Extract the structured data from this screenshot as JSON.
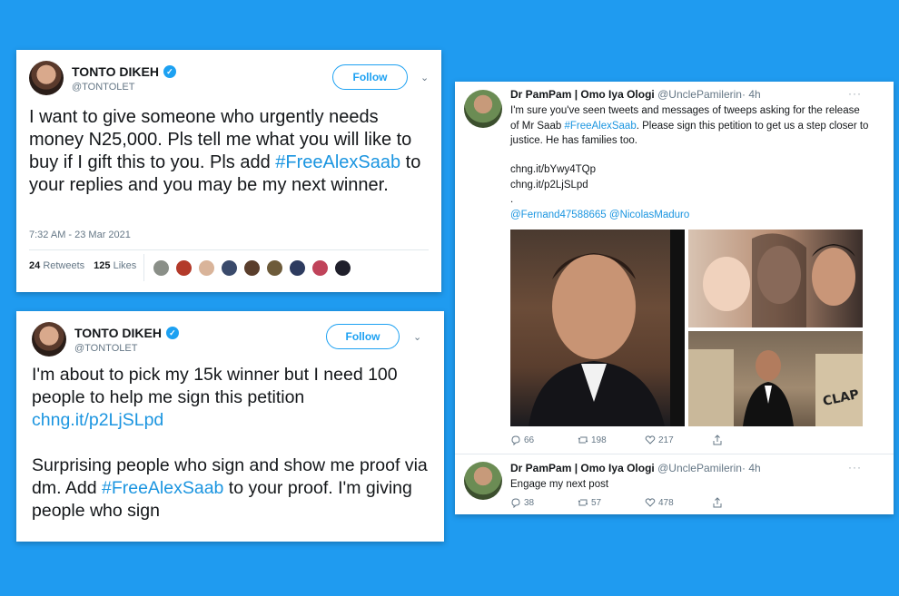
{
  "tweet1": {
    "display_name": "TONTO DIKEH",
    "handle": "@TONTOLET",
    "follow_label": "Follow",
    "text_before": "I want to give someone who urgently needs money N25,000. Pls tell me what you will like to buy if I gift this to you. Pls add ",
    "hashtag": "#FreeAlexSaab",
    "text_after": " to your replies and you may be my next winner.",
    "timestamp": "7:32 AM - 23 Mar 2021",
    "retweets_count": "24",
    "retweets_label": "Retweets",
    "likes_count": "125",
    "likes_label": "Likes"
  },
  "tweet2": {
    "display_name": "TONTO DIKEH",
    "handle": "@TONTOLET",
    "follow_label": "Follow",
    "line1": "I'm about to pick my 15k winner but I need 100 people to help me sign this petition",
    "link": "chng.it/p2LjSLpd",
    "para2_before": "Surprising people who sign and show me proof via dm. Add ",
    "hashtag": "#FreeAlexSaab",
    "para2_after": " to your proof. I'm giving people who sign"
  },
  "tweet3": {
    "display_name": "Dr PamPam | Omo Iya Ologi",
    "handle": "@UnclePamilerin",
    "time": "· 4h",
    "text_before": "I'm sure you've seen tweets and messages of tweeps asking for the release of Mr Saab ",
    "hashtag": "#FreeAlexSaab",
    "text_after": ". Please sign this petition to get us a step closer to justice. He has families too.",
    "link1": "chng.it/bYwy4TQp",
    "link2": "chng.it/p2LjSLpd",
    "dot": ".",
    "mention1": "@Fernand47588665",
    "mention2": "@NicolasMaduro",
    "photo_sign_text": "CLAP",
    "replies": "66",
    "retweets": "198",
    "likes": "217"
  },
  "tweet4": {
    "display_name": "Dr PamPam | Omo Iya Ologi",
    "handle": "@UnclePamilerin",
    "time": "· 4h",
    "text": "Engage my next post",
    "replies": "38",
    "retweets": "57",
    "likes": "478"
  },
  "colors": {
    "background": "#1f9bf0",
    "link": "#1b95e0",
    "verified": "#1da1f2"
  }
}
